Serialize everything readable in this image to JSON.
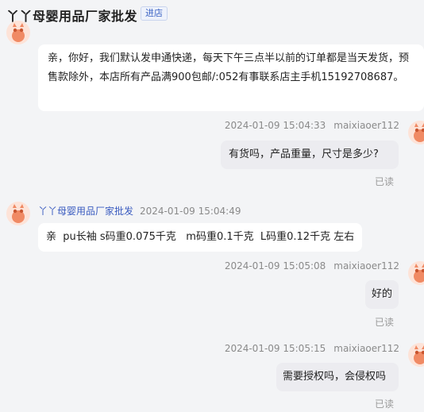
{
  "header": {
    "shop_name": "丫丫母婴用品厂家批发",
    "enter_label": "进店"
  },
  "messages": [
    {
      "side": "shop",
      "text": "亲，你好，我们默认发申通快递，每天下午三点半以前的订单都是当天发货，预售款除外，本店所有产品满900包邮/:052有事联系店主手机15192708687。"
    },
    {
      "side": "buyer",
      "time": "2024-01-09 15:04:33",
      "sender": "maixiaoer112",
      "text": "有货吗，产品重量，尺寸是多少?",
      "status": "已读"
    },
    {
      "side": "shop",
      "sender": "丫丫母婴用品厂家批发",
      "time": "2024-01-09 15:04:49",
      "text": "亲  pu长袖 s码重0.075千克   m码重0.1千克  L码重0.12千克 左右"
    },
    {
      "side": "buyer",
      "time": "2024-01-09 15:05:08",
      "sender": "maixiaoer112",
      "text": "好的",
      "status": "已读"
    },
    {
      "side": "buyer",
      "time": "2024-01-09 15:05:15",
      "sender": "maixiaoer112",
      "text": "需要授权吗，会侵权吗",
      "status": "已读"
    }
  ],
  "colors": {
    "background": "#f3f4f6",
    "shop_bubble": "#ffffff",
    "buyer_bubble": "#ececf0",
    "shop_name_link": "#3b5cc0",
    "enter_button": "#3b63c4"
  }
}
